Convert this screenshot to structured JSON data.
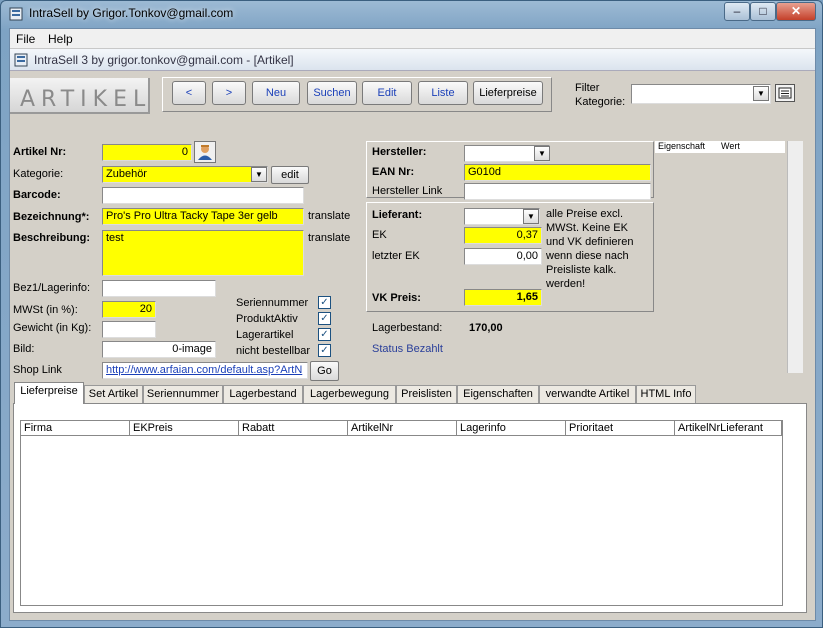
{
  "window": {
    "title": "IntraSell by Grigor.Tonkov@gmail.com",
    "min_glyph": "–",
    "max_glyph": "□",
    "close_glyph": "✕"
  },
  "menu": {
    "file": "File",
    "help": "Help"
  },
  "mdi": {
    "title": "IntraSell 3 by grigor.tonkov@gmail.com - [Artikel]"
  },
  "header": {
    "logo": "ARTIKEL",
    "buttons": {
      "prev": "<",
      "next": ">",
      "neu": "Neu",
      "suchen": "Suchen",
      "edit": "Edit",
      "liste": "Liste",
      "lieferpreise": "Lieferpreise"
    },
    "filter_label_1": "Filter",
    "filter_label_2": "Kategorie:",
    "filter_value": ""
  },
  "form": {
    "artikel_nr_label": "Artikel Nr:",
    "artikel_nr": "0",
    "kategorie_label": "Kategorie:",
    "kategorie": "Zubehör",
    "kategorie_edit": "edit",
    "barcode_label": "Barcode:",
    "barcode": "",
    "bezeichnung_label": "Bezeichnung*:",
    "bezeichnung": "Pro's Pro Ultra Tacky Tape 3er gelb",
    "translate1": "translate",
    "beschreibung_label": "Beschreibung:",
    "beschreibung": "test",
    "translate2": "translate",
    "bez1_label": "Bez1/Lagerinfo:",
    "bez1": "",
    "mwst_label": "MWSt (in %):",
    "mwst": "20",
    "gewicht_label": "Gewicht (in Kg):",
    "gewicht": "",
    "bild_label": "Bild:",
    "bild": "0-image",
    "shoplink_label": "Shop Link",
    "shoplink": "http://www.arfaian.com/default.asp?ArtN",
    "go": "Go",
    "checks": [
      {
        "label": "Seriennummer",
        "checked": true
      },
      {
        "label": "ProduktAktiv",
        "checked": true
      },
      {
        "label": "Lagerartikel",
        "checked": true
      },
      {
        "label": "nicht bestellbar",
        "checked": true
      }
    ],
    "check_glyph": "✓"
  },
  "hersteller": {
    "hersteller_label": "Hersteller:",
    "hersteller": "",
    "ean_label": "EAN Nr:",
    "ean": "G010d",
    "link_label": "Hersteller Link",
    "link": ""
  },
  "lieferant": {
    "label": "Lieferant:",
    "value": "",
    "note": [
      "alle Preise excl.",
      "MWSt.  Keine EK",
      "und VK definieren",
      "wenn diese nach",
      "Preisliste kalk.",
      "werden!"
    ],
    "ek_label": "EK",
    "ek": "0,37",
    "letzter_ek_label": "letzter EK",
    "letzter_ek": "0,00",
    "vk_label": "VK Preis:",
    "vk": "1,65",
    "lagerbestand_label": "Lagerbestand:",
    "lagerbestand": "170,00",
    "status": "Status Bezahlt"
  },
  "props": {
    "col1": "Eigenschaft",
    "col2": "Wert"
  },
  "tabs": [
    "Lieferpreise",
    "Set Artikel",
    "Seriennummer",
    "Lagerbestand",
    "Lagerbewegung",
    "Preislisten",
    "Eigenschaften",
    "verwandte Artikel",
    "HTML Info"
  ],
  "grid": {
    "columns": [
      "Firma",
      "EKPreis",
      "Rabatt",
      "ArtikelNr",
      "Lagerinfo",
      "Prioritaet",
      "ArtikelNrLieferant"
    ]
  },
  "colors": {
    "yellow_field": "#ffff00",
    "link_blue": "#1a3fb8",
    "status_blue": "#2a3f9a"
  }
}
